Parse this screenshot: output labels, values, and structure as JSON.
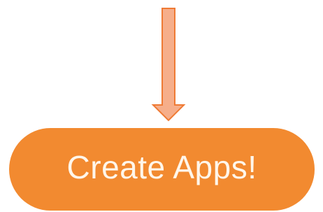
{
  "cta": {
    "label": "Create Apps!"
  },
  "colors": {
    "button_fill": "#f28a30",
    "button_text": "#fff6ea",
    "arrow_fill": "#f6ae8a",
    "arrow_stroke": "#ef7a34"
  },
  "icons": {
    "pointer": "down-arrow-icon"
  }
}
